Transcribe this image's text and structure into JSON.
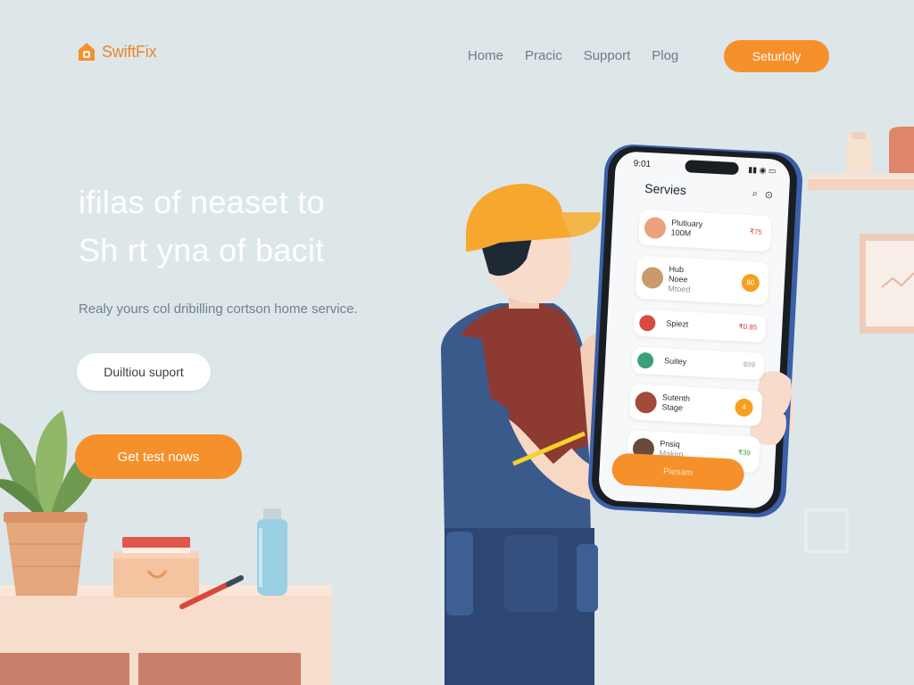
{
  "brand": {
    "name": "SwiftFix",
    "accent": "#f6902b",
    "logo_icon": "house-icon"
  },
  "nav": {
    "items": [
      "Home",
      "Pracic",
      "Support",
      "Plog"
    ],
    "cta_label": "Seturloly"
  },
  "hero": {
    "title_line1": "ifilas of neaset to",
    "title_line2": "Sh rt yna of bacit",
    "subtitle": "Realy yours col dribilling cortson home service.",
    "secondary_button": "Duiltiou suport",
    "primary_button": "Get test nows"
  },
  "phone": {
    "status_time": "9:01",
    "status_icons": "▮▮ ◉ ▭",
    "title": "Servies",
    "header_icons": [
      "search-icon",
      "settings-icon"
    ],
    "services": [
      {
        "name": "Plutiuary",
        "sub": "100M",
        "meta": "₹75",
        "meta_color": "#d9443a",
        "avatar_color": "#e9a27c"
      },
      {
        "name": "Hub",
        "sub": "Noee",
        "sub2": "Mtoed",
        "badge": "80",
        "avatar_color": "#c99a6c"
      },
      {
        "name": "Spiezt",
        "meta": "₹0.85",
        "meta_color": "#d9443a",
        "avatar_color": "#d74a40"
      },
      {
        "name": "Suitey",
        "meta": "$99",
        "meta_color": "#9aa6ad",
        "avatar_color": "#3aa27a"
      },
      {
        "name": "Sutenth",
        "sub": "Stage",
        "badge": "4",
        "avatar_color": "#a24b3a"
      },
      {
        "name": "Pnsiq",
        "sub": "Makirg",
        "meta": "₹39",
        "meta_color": "#3fa34d",
        "avatar_color": "#6a4a3a"
      }
    ],
    "cta_label": "Piesam"
  },
  "colors": {
    "background": "#dde7ea",
    "orange": "#f6902b",
    "subtitle": "#72808a",
    "nav": "#6e7c85"
  }
}
